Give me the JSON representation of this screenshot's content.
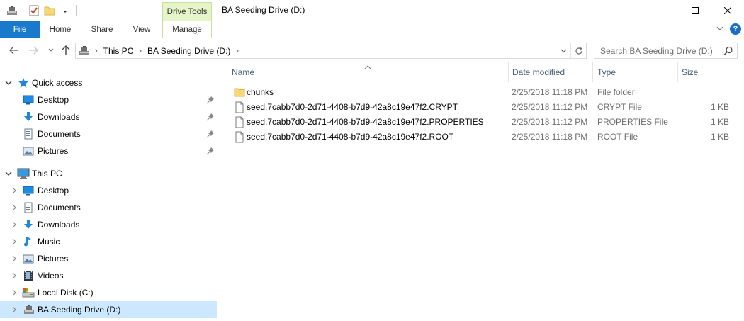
{
  "window": {
    "title": "BA Seeding Drive (D:)",
    "context_tab_group": "Drive Tools"
  },
  "ribbon": {
    "tabs": [
      {
        "label": "File"
      },
      {
        "label": "Home"
      },
      {
        "label": "Share"
      },
      {
        "label": "View"
      },
      {
        "label": "Manage"
      }
    ],
    "help_label": "?"
  },
  "address": {
    "crumbs": [
      "This PC",
      "BA Seeding Drive (D:)"
    ],
    "search_placeholder": "Search BA Seeding Drive (D:)"
  },
  "nav": {
    "quick_access": {
      "label": "Quick access",
      "items": [
        {
          "label": "Desktop",
          "icon": "desktop-icon"
        },
        {
          "label": "Downloads",
          "icon": "downloads-icon"
        },
        {
          "label": "Documents",
          "icon": "documents-icon"
        },
        {
          "label": "Pictures",
          "icon": "pictures-icon"
        }
      ]
    },
    "this_pc": {
      "label": "This PC",
      "items": [
        {
          "label": "Desktop",
          "icon": "desktop-icon"
        },
        {
          "label": "Documents",
          "icon": "documents-icon"
        },
        {
          "label": "Downloads",
          "icon": "downloads-icon"
        },
        {
          "label": "Music",
          "icon": "music-icon"
        },
        {
          "label": "Pictures",
          "icon": "pictures-icon"
        },
        {
          "label": "Videos",
          "icon": "videos-icon"
        },
        {
          "label": "Local Disk (C:)",
          "icon": "local-disk-icon"
        },
        {
          "label": "BA Seeding Drive (D:)",
          "icon": "usb-drive-icon",
          "selected": true
        }
      ]
    }
  },
  "columns": {
    "name": "Name",
    "date": "Date modified",
    "type": "Type",
    "size": "Size"
  },
  "files": [
    {
      "name": "chunks",
      "date": "2/25/2018 11:18 PM",
      "type": "File folder",
      "size": "",
      "icon": "folder-icon"
    },
    {
      "name": "seed.7cabb7d0-2d71-4408-b7d9-42a8c19e47f2.CRYPT",
      "date": "2/25/2018 11:12 PM",
      "type": "CRYPT File",
      "size": "1 KB",
      "icon": "file-icon"
    },
    {
      "name": "seed.7cabb7d0-2d71-4408-b7d9-42a8c19e47f2.PROPERTIES",
      "date": "2/25/2018 11:12 PM",
      "type": "PROPERTIES File",
      "size": "1 KB",
      "icon": "file-icon"
    },
    {
      "name": "seed.7cabb7d0-2d71-4408-b7d9-42a8c19e47f2.ROOT",
      "date": "2/25/2018 11:18 PM",
      "type": "ROOT File",
      "size": "1 KB",
      "icon": "file-icon"
    }
  ],
  "colors": {
    "file_tab": "#1979ca",
    "drive_tools_tab": "#e6f4c9",
    "selection": "#cce8ff",
    "header_text": "#4c607a"
  }
}
